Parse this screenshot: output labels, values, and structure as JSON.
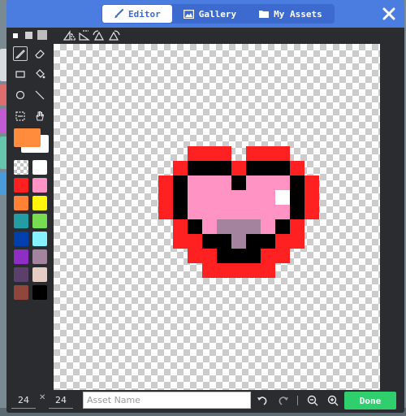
{
  "header": {
    "tabs": [
      {
        "label": "Editor",
        "icon": "paintbrush-icon",
        "active": true
      },
      {
        "label": "Gallery",
        "icon": "image-icon",
        "active": false
      },
      {
        "label": "My Assets",
        "icon": "folder-icon",
        "active": false
      }
    ],
    "close_icon": "close-icon"
  },
  "toolbar": {
    "brush_sizes": [
      "small",
      "medium",
      "large"
    ],
    "icons": [
      "flip-horizontal-icon",
      "flip-vertical-icon",
      "rotate-left-icon",
      "rotate-right-icon"
    ]
  },
  "tools": [
    {
      "name": "pencil-tool",
      "icon": "pencil-icon",
      "selected": true
    },
    {
      "name": "eraser-tool",
      "icon": "eraser-icon",
      "selected": false
    },
    {
      "name": "rectangle-tool",
      "icon": "rectangle-icon",
      "selected": false
    },
    {
      "name": "fill-tool",
      "icon": "paint-bucket-icon",
      "selected": false
    },
    {
      "name": "circle-tool",
      "icon": "circle-icon",
      "selected": false
    },
    {
      "name": "line-tool",
      "icon": "line-icon",
      "selected": false
    },
    {
      "name": "marquee-tool",
      "icon": "marquee-icon",
      "selected": false
    },
    {
      "name": "pan-tool",
      "icon": "hand-icon",
      "selected": false
    }
  ],
  "colors": {
    "primary": "#ff8b3d",
    "secondary": "#ffffff",
    "palette": [
      "transparent",
      "#ffffff",
      "#ff2121",
      "#ff93c4",
      "#ff8135",
      "#fff609",
      "#249ca3",
      "#78dc52",
      "#003fad",
      "#87f2ff",
      "#8e2ec4",
      "#a4839f",
      "#5c406c",
      "#e5cdc4",
      "#91463d",
      "#000000"
    ]
  },
  "canvas": {
    "pixel_colors": {
      "R": "#ff2121",
      "K": "#000000",
      "P": "#ff93c4",
      "W": "#ffffff",
      "M": "#a4839f"
    },
    "rows": [
      "................",
      "................",
      "................",
      "................",
      "................",
      "................",
      "................",
      "......RRR.RRR...",
      ".....RKKKRKKKR..",
      "....RKPPPKPPPKR.",
      "....RKPPPPPPWKR.",
      "....RKPPPPPPPKR.",
      ".....RKPMMMPKR..",
      ".....RRKKMKKRR..",
      "......RRKKKRR...",
      ".......RRRRR...."
    ]
  },
  "bottom": {
    "width": "24",
    "height": "24",
    "asset_name_placeholder": "Asset Name",
    "done_label": "Done"
  }
}
